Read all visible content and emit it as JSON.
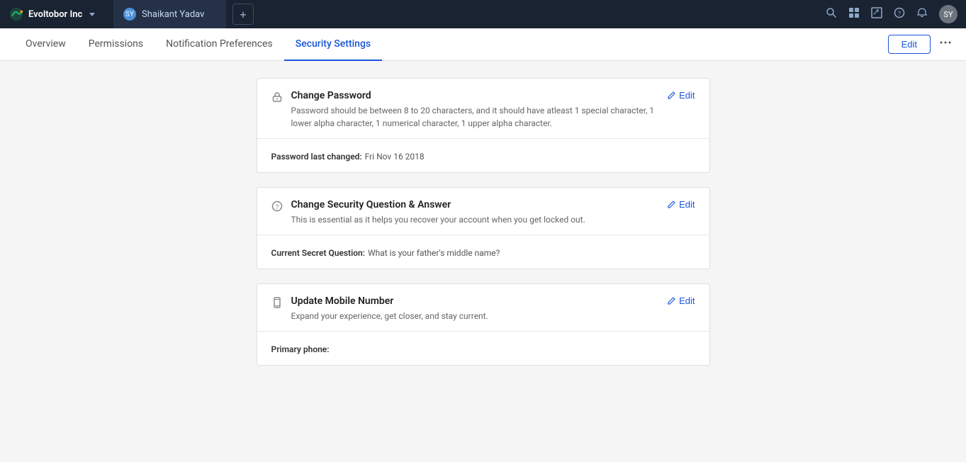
{
  "navbar": {
    "logo_text": "Evoltobor Inc",
    "tab_user_initials": "SY",
    "tab_user_name": "Shaikant Yadav",
    "add_label": "+",
    "icons": {
      "search": "🔍",
      "bookmark": "🔖",
      "edit": "✏️",
      "help": "❓",
      "bell": "🔔"
    },
    "avatar_initials": "SY"
  },
  "sub_nav": {
    "tabs": [
      {
        "id": "overview",
        "label": "Overview",
        "active": false
      },
      {
        "id": "permissions",
        "label": "Permissions",
        "active": false
      },
      {
        "id": "notification-preferences",
        "label": "Notification Preferences",
        "active": false
      },
      {
        "id": "security-settings",
        "label": "Security Settings",
        "active": true
      }
    ],
    "edit_button_label": "Edit",
    "more_icon": "•••"
  },
  "cards": [
    {
      "id": "change-password",
      "icon": "🔑",
      "title": "Change Password",
      "description": "Password should be between 8 to 20 characters, and it should have atleast 1 special character, 1 lower alpha character, 1 numerical character, 1 upper alpha character.",
      "edit_label": "Edit",
      "info_label": "Password last changed:",
      "info_value": "  Fri Nov 16 2018"
    },
    {
      "id": "change-security-question",
      "icon": "❓",
      "title": "Change Security Question & Answer",
      "description": "This is essential as it helps you recover your account when you get locked out.",
      "edit_label": "Edit",
      "info_label": "Current Secret Question:",
      "info_value": "  What is your father's middle name?"
    },
    {
      "id": "update-mobile-number",
      "icon": "📋",
      "title": "Update Mobile Number",
      "description": "Expand your experience, get closer, and stay current.",
      "edit_label": "Edit",
      "info_label": "Primary phone:",
      "info_value": ""
    }
  ]
}
